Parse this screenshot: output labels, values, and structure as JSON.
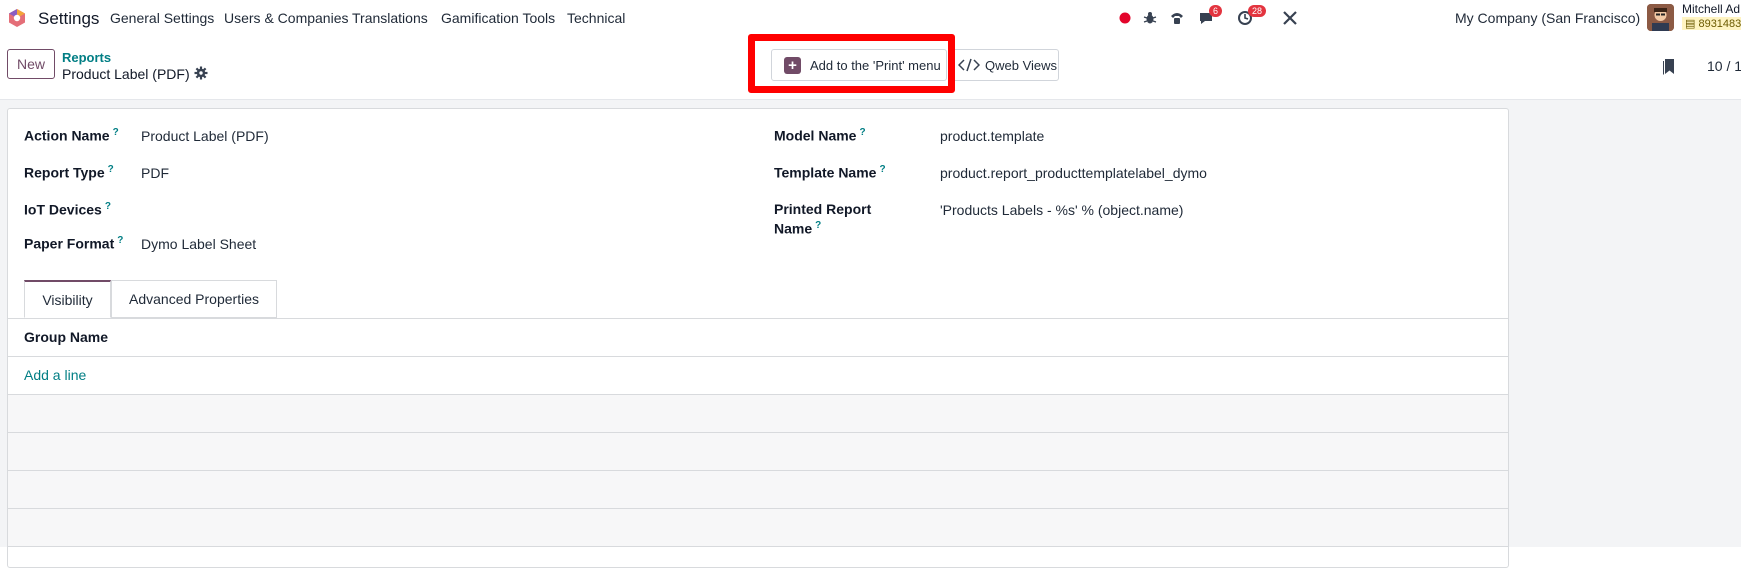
{
  "navbar": {
    "app_name": "Settings",
    "menu": [
      "General Settings",
      "Users & Companies",
      "Translations",
      "Gamification Tools",
      "Technical"
    ],
    "messages_badge": "6",
    "activities_badge": "28",
    "company": "My Company (San Francisco)",
    "user_name": "Mitchell Ad",
    "user_db": "8931483"
  },
  "control_panel": {
    "new_label": "New",
    "breadcrumb_parent": "Reports",
    "breadcrumb_current": "Product Label (PDF)",
    "print_menu_label": "Add to the 'Print' menu",
    "qweb_label": "Qweb Views",
    "pager": "10 / 1"
  },
  "form": {
    "left": [
      {
        "label": "Action Name",
        "value": "Product Label (PDF)"
      },
      {
        "label": "Report Type",
        "value": "PDF"
      },
      {
        "label": "IoT Devices",
        "value": ""
      },
      {
        "label": "Paper Format",
        "value": "Dymo Label Sheet"
      }
    ],
    "right": [
      {
        "label": "Model Name",
        "value": "product.template"
      },
      {
        "label": "Template Name",
        "value": "product.report_producttemplatelabel_dymo"
      },
      {
        "label_line1": "Printed Report",
        "label_line2": "Name",
        "value": "'Products Labels - %s' % (object.name)"
      }
    ],
    "help_mark": "?"
  },
  "tabs": [
    "Visibility",
    "Advanced Properties"
  ],
  "group_table": {
    "header": "Group Name",
    "add_line": "Add a line"
  },
  "colors": {
    "brand": "#714b67",
    "link": "#017e84",
    "highlight": "#ff0000",
    "badge": "#e3343f"
  }
}
